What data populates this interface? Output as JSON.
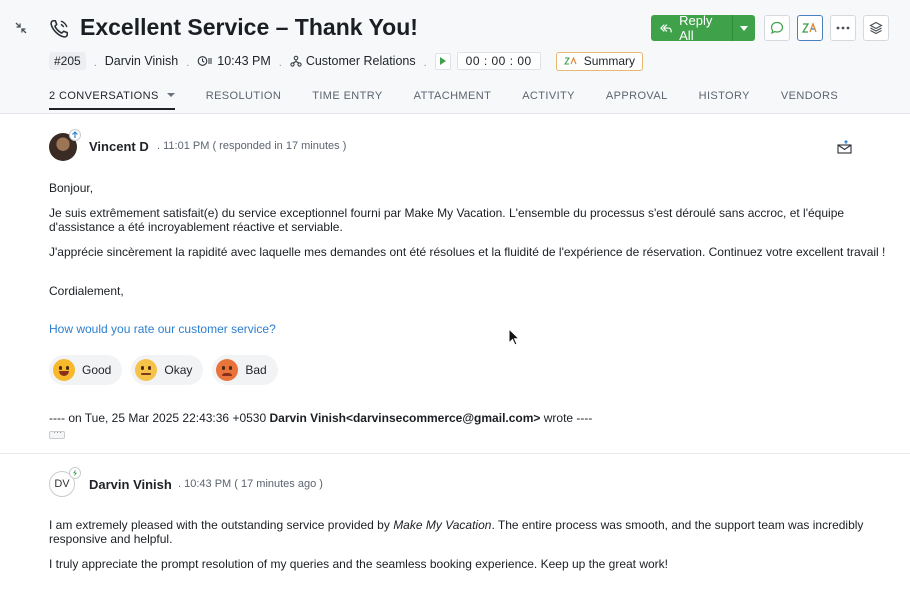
{
  "ticket": {
    "title": "Excellent Service – Thank You!",
    "id": "#205",
    "contact": "Darvin Vinish",
    "due_time": "10:43 PM",
    "department": "Customer Relations",
    "timer": "00 : 00 : 00",
    "summary_label": "Summary"
  },
  "actions": {
    "reply_all_label": "Reply All"
  },
  "tabs": [
    {
      "label": "2 CONVERSATIONS",
      "active": true
    },
    {
      "label": "RESOLUTION"
    },
    {
      "label": "TIME ENTRY"
    },
    {
      "label": "ATTACHMENT"
    },
    {
      "label": "ACTIVITY"
    },
    {
      "label": "APPROVAL"
    },
    {
      "label": "HISTORY"
    },
    {
      "label": "VENDORS"
    }
  ],
  "conversations": [
    {
      "sender": "Vincent D",
      "time": "11:01 PM ( responded in 17 minutes )",
      "paragraphs": [
        "Bonjour,",
        "Je suis extrêmement satisfait(e) du service exceptionnel fourni par Make My Vacation. L'ensemble du processus s'est déroulé sans accroc, et l'équipe d'assistance a été incroyablement réactive et serviable.",
        "J'apprécie sincèrement la rapidité avec laquelle mes demandes ont été résolues et la fluidité de l'expérience de réservation. Continuez votre excellent travail !",
        "Cordialement,"
      ],
      "rating_prompt": "How would you rate our customer service?",
      "ratings": [
        "Good",
        "Okay",
        "Bad"
      ],
      "quote_prefix": "---- on Tue, 25 Mar 2025 22:43:36 +0530 ",
      "quote_author": "Darvin Vinish<darvinsecommerce@gmail.com>",
      "quote_suffix": " wrote ----"
    },
    {
      "sender": "Darvin Vinish",
      "initials": "DV",
      "time": "10:43 PM ( 17 minutes ago )",
      "p1_before": "I am extremely pleased with the outstanding service provided by ",
      "p1_em": "Make My Vacation",
      "p1_after": ". The entire process was smooth, and the support team was incredibly responsive and helpful.",
      "p2": "I truly appreciate the prompt resolution of my queries and the seamless booking experience. Keep up the great work!"
    }
  ],
  "colors": {
    "reply_green": "#3fa14a",
    "link_blue": "#2c7fd0",
    "summary_border": "#e7b86f"
  },
  "icons": [
    "collapse-icon",
    "phone-icon",
    "reply-all-icon",
    "chevron-down-icon",
    "chat-icon",
    "zia-icon",
    "more-icon",
    "layers-icon",
    "clock-icon",
    "department-icon",
    "play-icon",
    "summary-icon",
    "reply-mail-icon",
    "emoji-good-icon",
    "emoji-okay-icon",
    "emoji-bad-icon"
  ]
}
